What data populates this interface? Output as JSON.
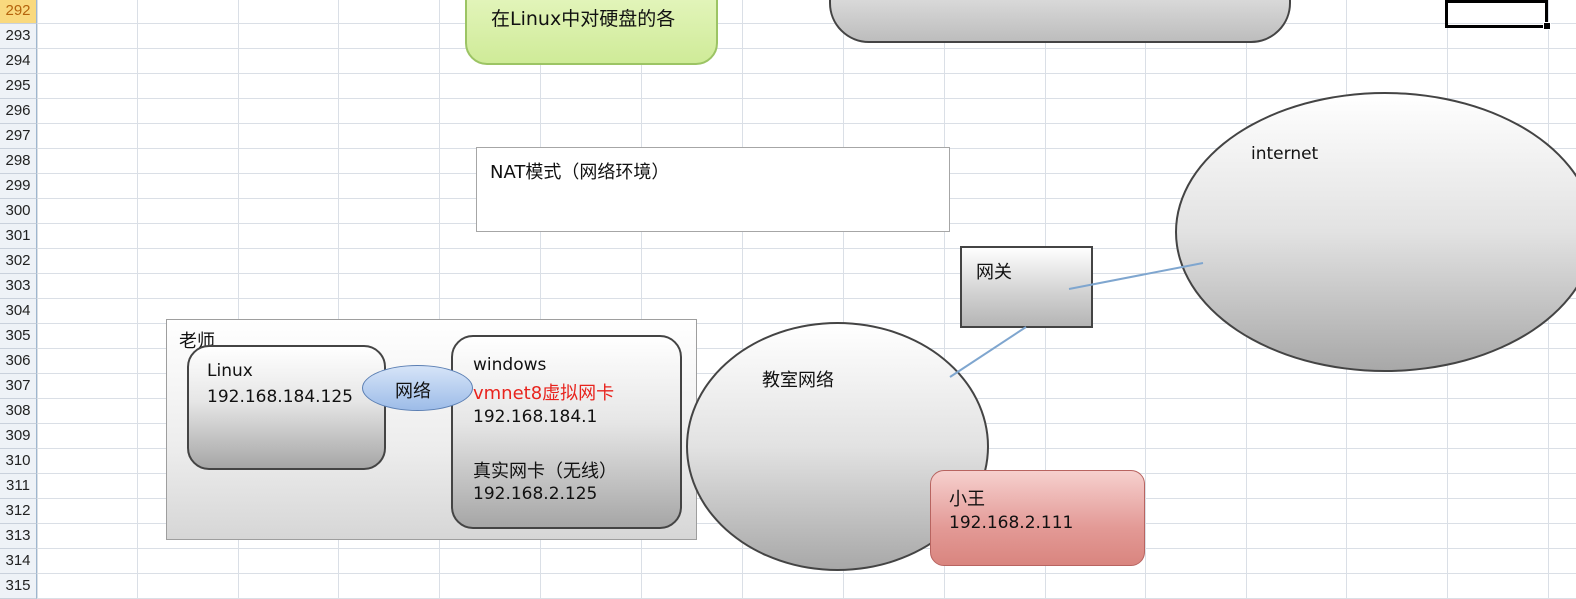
{
  "spreadsheet": {
    "row_headers": [
      "292",
      "293",
      "294",
      "295",
      "296",
      "297",
      "298",
      "299",
      "300",
      "301",
      "302",
      "303",
      "304",
      "305",
      "306",
      "307",
      "308",
      "309",
      "310",
      "311",
      "312",
      "313",
      "314",
      "315"
    ],
    "active_row": "292"
  },
  "diagram": {
    "green_note": "在Linux中对硬盘的各",
    "nat_box": "NAT模式（网络环境）",
    "teacher_label": "老师",
    "linux_box": {
      "title": "Linux",
      "ip": "192.168.184.125"
    },
    "network_oval": "网络",
    "windows_box": {
      "title": "windows",
      "vmnet": "vmnet8虚拟网卡",
      "vmnet_ip": "192.168.184.1",
      "real_nic": "真实网卡（无线）",
      "real_ip": "192.168.2.125"
    },
    "classroom_net": "教室网络",
    "gateway": "网关",
    "internet": "internet",
    "xiaowang": {
      "name": "小王",
      "ip": "192.168.2.111"
    }
  },
  "colors": {
    "green_fill": "#d7f0a6",
    "red_text": "#e8231d",
    "pink_fill": "#e89a96",
    "oval_blue": "#a9c6ee",
    "connector": "#7fa6cf"
  }
}
